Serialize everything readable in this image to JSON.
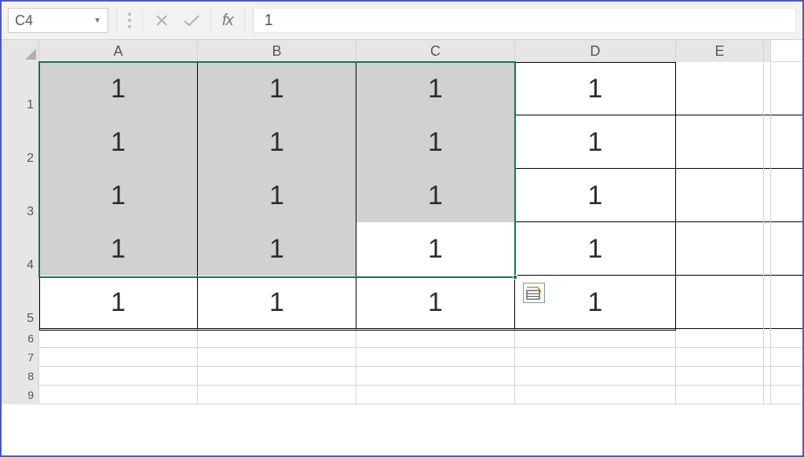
{
  "formula_bar": {
    "name_box": "C4",
    "fx_label": "fx",
    "formula_value": "1"
  },
  "columns": [
    "A",
    "B",
    "C",
    "D",
    "E",
    ""
  ],
  "rows_tall": [
    "1",
    "2",
    "3",
    "4",
    "5"
  ],
  "rows_short": [
    "6",
    "7",
    "8",
    "9"
  ],
  "grid": {
    "r1": {
      "A": "1",
      "B": "1",
      "C": "1",
      "D": "1",
      "E": ""
    },
    "r2": {
      "A": "1",
      "B": "1",
      "C": "1",
      "D": "1",
      "E": ""
    },
    "r3": {
      "A": "1",
      "B": "1",
      "C": "1",
      "D": "1",
      "E": ""
    },
    "r4": {
      "A": "1",
      "B": "1",
      "C": "1",
      "D": "1",
      "E": ""
    },
    "r5": {
      "A": "1",
      "B": "1",
      "C": "1",
      "D": "1",
      "E": ""
    }
  },
  "selection": {
    "active_cell": "C4",
    "range": "A1:C4"
  }
}
